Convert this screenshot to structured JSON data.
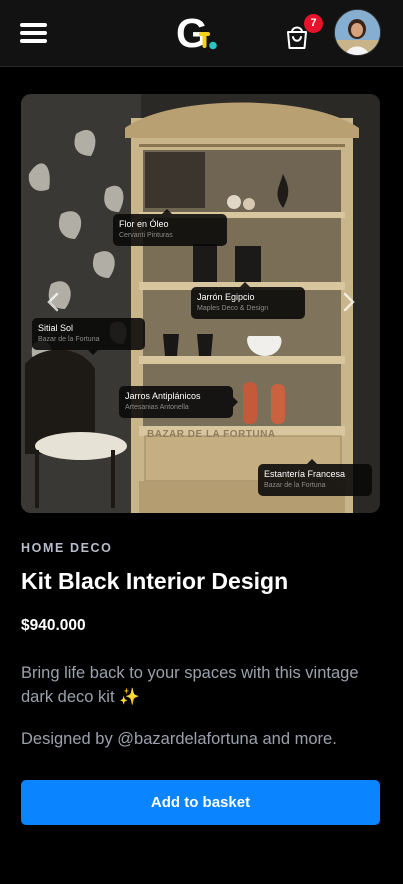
{
  "header": {
    "menu_icon": "hamburger-menu-icon",
    "logo_letter": "G",
    "bag_icon": "shopping-bag-icon",
    "cart_count": "7",
    "colors": {
      "background": "#121212",
      "badge": "#e8132a",
      "logo_accent_yellow": "#f4d11b",
      "logo_accent_teal": "#27c6c4"
    }
  },
  "product_image": {
    "watermark": "BAZAR DE LA FORTUNA",
    "prev_icon": "chevron-left-icon",
    "next_icon": "chevron-right-icon",
    "tags": [
      {
        "name": "Flor en Óleo",
        "shop": "Cervanti Pinturas"
      },
      {
        "name": "Jarrón Egipcio",
        "shop": "Maples Deco & Design"
      },
      {
        "name": "Sitial Sol",
        "shop": "Bazar de la Fortuna"
      },
      {
        "name": "Jarros Antiplánicos",
        "shop": "Artesanias Antonella"
      },
      {
        "name": "Estantería Francesa",
        "shop": "Bazar de la Fortuna"
      }
    ]
  },
  "product": {
    "category": "HOME DECO",
    "title": "Kit Black Interior Design",
    "price": "$940.000",
    "description": "Bring life back to your spaces with this vintage dark deco kit ✨",
    "credit": "Designed by @bazardelafortuna and more.",
    "add_button_label": "Add to basket",
    "accent_color": "#0a84ff"
  }
}
